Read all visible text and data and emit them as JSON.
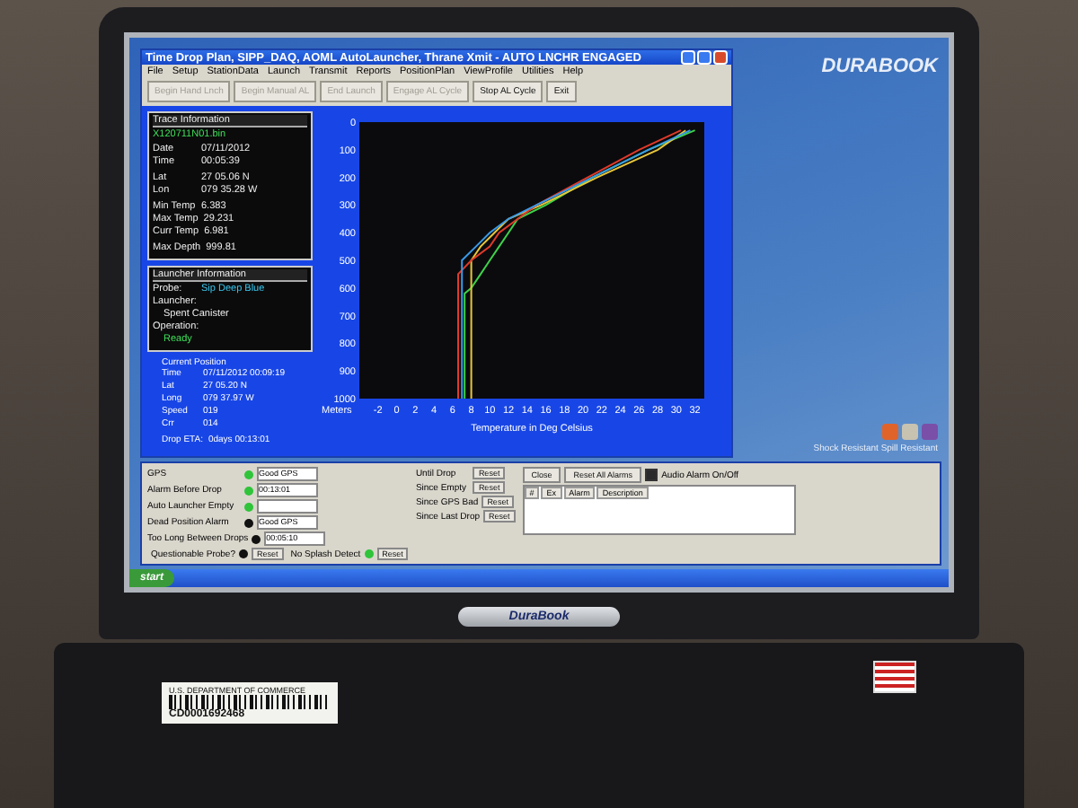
{
  "window": {
    "title": "Time Drop Plan,  SIPP_DAQ, AOML AutoLauncher, Thrane Xmit - AUTO LNCHR ENGAGED"
  },
  "menu": [
    "File",
    "Setup",
    "StationData",
    "Launch",
    "Transmit",
    "Reports",
    "PositionPlan",
    "ViewProfile",
    "Utilities",
    "Help"
  ],
  "toolbar": [
    {
      "label": "Begin Hand Lnch",
      "disabled": true
    },
    {
      "label": "Begin Manual AL",
      "disabled": true
    },
    {
      "label": "End Launch",
      "disabled": true
    },
    {
      "label": "Engage AL Cycle",
      "disabled": true
    },
    {
      "label": "Stop AL Cycle",
      "disabled": false
    },
    {
      "label": "Exit",
      "disabled": false
    }
  ],
  "trace_info": {
    "title": "Trace Information",
    "file": "X120711N01.bin",
    "groups": [
      [
        {
          "label": "Date",
          "value": "07/11/2012"
        },
        {
          "label": "Time",
          "value": "00:05:39"
        }
      ],
      [
        {
          "label": "Lat",
          "value": "27 05.06 N"
        },
        {
          "label": "Lon",
          "value": "079 35.28 W"
        }
      ],
      [
        {
          "label": "Min Temp",
          "value": "6.383"
        },
        {
          "label": "Max Temp",
          "value": "29.231"
        },
        {
          "label": "Curr Temp",
          "value": "6.981"
        }
      ],
      [
        {
          "label": "Max Depth",
          "value": "999.81"
        }
      ]
    ]
  },
  "launcher_info": {
    "title": "Launcher Information",
    "probe_label": "Probe:",
    "probe": "Sip Deep Blue",
    "launcher_label": "Launcher:",
    "launcher": "Spent Canister",
    "operation_label": "Operation:",
    "operation": "Ready"
  },
  "current_position": {
    "title": "Current Position",
    "fields": [
      {
        "label": "Time",
        "value": "07/11/2012 00:09:19"
      },
      {
        "label": "Lat",
        "value": "27 05.20 N"
      },
      {
        "label": "Long",
        "value": "079 37.97 W"
      },
      {
        "label": "Speed",
        "value": "019"
      },
      {
        "label": "Crr",
        "value": "014"
      }
    ],
    "eta_label": "Drop ETA:",
    "eta": "0days 00:13:01"
  },
  "chart_data": {
    "type": "line",
    "xlabel": "Temperature in Deg Celsius",
    "ylabel": "Meters",
    "xlim": [
      -4,
      33
    ],
    "ylim": [
      1000,
      0
    ],
    "xticks": [
      -2,
      0,
      2,
      4,
      6,
      8,
      10,
      12,
      14,
      16,
      18,
      20,
      22,
      24,
      26,
      28,
      30,
      32
    ],
    "yticks": [
      0,
      100,
      200,
      300,
      400,
      500,
      600,
      700,
      800,
      900,
      1000
    ],
    "series": [
      {
        "color": "#3fd24a",
        "x": [
          32,
          27,
          21,
          16,
          13,
          12,
          11,
          10,
          9,
          8,
          7.3,
          7.3
        ],
        "values": [
          30,
          100,
          200,
          300,
          350,
          400,
          450,
          500,
          550,
          600,
          620,
          1000
        ]
      },
      {
        "color": "#e8c63a",
        "x": [
          31,
          28,
          21.5,
          15.5,
          12,
          10.5,
          9,
          8,
          8,
          8,
          8,
          8
        ],
        "values": [
          30,
          100,
          200,
          300,
          350,
          400,
          450,
          500,
          550,
          600,
          620,
          1000
        ]
      },
      {
        "color": "#e03a2a",
        "x": [
          30.5,
          26,
          20.5,
          15,
          13,
          11,
          10,
          8,
          6.6,
          6.6,
          6.6,
          6.6
        ],
        "values": [
          30,
          100,
          200,
          300,
          350,
          400,
          450,
          500,
          550,
          600,
          620,
          1000
        ]
      },
      {
        "color": "#3a9ae8",
        "x": [
          31.5,
          27,
          21,
          15,
          12,
          10,
          8.5,
          7,
          7,
          7,
          7,
          7
        ],
        "values": [
          30,
          100,
          200,
          300,
          350,
          400,
          450,
          500,
          550,
          600,
          620,
          1000
        ]
      }
    ]
  },
  "alarms": {
    "status": [
      {
        "label": "GPS",
        "color": "#2fc43a",
        "value": "Good GPS"
      },
      {
        "label": "Alarm Before Drop",
        "color": "#2fc43a",
        "value": "00:13:01"
      },
      {
        "label": "Auto Launcher Empty",
        "color": "#2fc43a"
      },
      {
        "label": "Dead Position Alarm",
        "color": "#111111",
        "value": "Good GPS"
      },
      {
        "label": "Too Long Between Drops",
        "color": "#111111",
        "value": "00:05:10"
      }
    ],
    "timers": [
      {
        "label": "Until Drop",
        "reset": "Reset"
      },
      {
        "label": "Since Empty",
        "reset": "Reset"
      },
      {
        "label": "Since GPS Bad",
        "reset": "Reset"
      },
      {
        "label": "Since Last Drop",
        "reset": "Reset"
      }
    ],
    "checks": [
      {
        "label": "Questionable Probe?",
        "color": "#111111",
        "reset": "Reset"
      },
      {
        "label": "No Splash Detect",
        "color": "#2fc43a",
        "reset": "Reset"
      }
    ],
    "close": "Close",
    "reset_all": "Reset All Alarms",
    "audio": {
      "label": "Audio Alarm On/Off",
      "checked": true
    },
    "columns": [
      "#",
      "Ex",
      "Alarm",
      "Description"
    ]
  },
  "taskbar": {
    "start": "start"
  },
  "desktop": {
    "logo": "DURABOOK",
    "tagline": "Shock Resistant  Spill Resistant"
  },
  "bezel": {
    "logo": "DuraBook"
  },
  "label_sticker": {
    "agency": "U.S. DEPARTMENT OF COMMERCE",
    "number": "CD0001692468"
  }
}
